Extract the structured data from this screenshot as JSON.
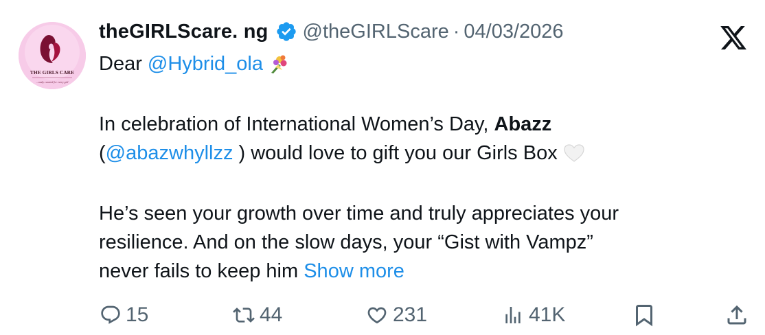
{
  "author": {
    "name": "theGIRLScare. ng",
    "handle": "@theGIRLScare",
    "separator": "·",
    "date": "04/03/2026",
    "avatar_text": "THE GIRLS CARE",
    "avatar_tagline": "...ously curated for every girl"
  },
  "tweet": {
    "greeting": "Dear",
    "mention_to": "@Hybrid_ola",
    "para1_pre": "In celebration of International Women’s Day,",
    "para1_bold": "Abazz",
    "para1_open": "(",
    "para1_mention": "@abazwhyllzz",
    "para1_post": ") would love to gift you our Girls Box",
    "para2_line1": "He’s seen your growth over time and truly appreciates your",
    "para2_line2": "resilience. And on the slow days, your “Gist with Vampz”",
    "para2_line3": "never fails to keep him",
    "show_more": "Show more"
  },
  "actions": {
    "replies": "15",
    "retweets": "44",
    "likes": "231",
    "views": "41K"
  },
  "icons": [
    "verified-badge-icon",
    "x-logo-icon",
    "bouquet-emoji-icon",
    "white-heart-emoji-icon",
    "reply-icon",
    "retweet-icon",
    "like-icon",
    "views-icon",
    "bookmark-icon",
    "share-icon"
  ],
  "colors": {
    "link": "#1d8ee8",
    "muted": "#536471",
    "verified": "#1d9bf0",
    "text": "#0f1419"
  }
}
